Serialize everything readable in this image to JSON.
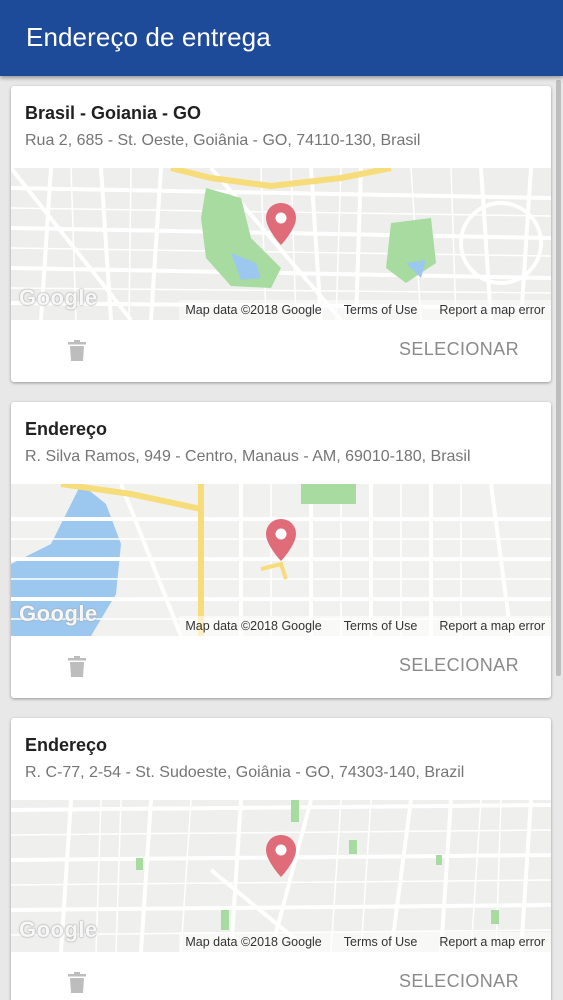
{
  "appbar": {
    "title": "Endereço de entrega"
  },
  "map_footer": {
    "data": "Map data ©2018 Google",
    "terms": "Terms of Use",
    "report": "Report a map error"
  },
  "google_logo": "Google",
  "cards": [
    {
      "title": "Brasil - Goiania - GO",
      "address": "Rua 2, 685 - St. Oeste, Goiânia - GO, 74110-130, Brasil",
      "select_label": "SELECIONAR"
    },
    {
      "title": "Endereço",
      "address": "R. Silva Ramos, 949 - Centro, Manaus - AM, 69010-180, Brasil",
      "select_label": "SELECIONAR"
    },
    {
      "title": "Endereço",
      "address": "R. C-77, 2-54 - St. Sudoeste, Goiânia - GO, 74303-140, Brazil",
      "select_label": "SELECIONAR"
    }
  ],
  "colors": {
    "appbar": "#1d4a99",
    "pin": "#e06c7a",
    "park": "#a8dba0",
    "water": "#9cc8f0",
    "highway": "#f7dc7a"
  },
  "icons": [
    "map-pin-icon",
    "trash-icon"
  ]
}
